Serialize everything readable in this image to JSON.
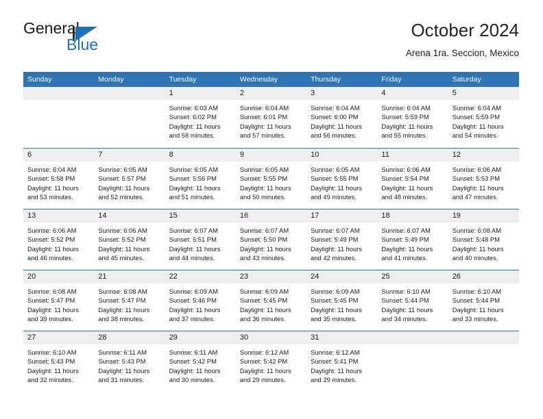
{
  "brand": {
    "name_part1": "General",
    "name_part2": "Blue",
    "logo_icon": "general-blue-triangle-logo",
    "accent_color": "#1c72b8"
  },
  "header": {
    "title": "October 2024",
    "subtitle": "Arena 1ra. Seccion, Mexico"
  },
  "calendar": {
    "header_bg": "#2f74b5",
    "weekdays": [
      "Sunday",
      "Monday",
      "Tuesday",
      "Wednesday",
      "Thursday",
      "Friday",
      "Saturday"
    ],
    "weeks": [
      [
        {
          "day": "",
          "lines": []
        },
        {
          "day": "",
          "lines": []
        },
        {
          "day": "1",
          "lines": [
            "Sunrise: 6:03 AM",
            "Sunset: 6:02 PM",
            "Daylight: 11 hours",
            "and 58 minutes."
          ]
        },
        {
          "day": "2",
          "lines": [
            "Sunrise: 6:04 AM",
            "Sunset: 6:01 PM",
            "Daylight: 11 hours",
            "and 57 minutes."
          ]
        },
        {
          "day": "3",
          "lines": [
            "Sunrise: 6:04 AM",
            "Sunset: 6:00 PM",
            "Daylight: 11 hours",
            "and 56 minutes."
          ]
        },
        {
          "day": "4",
          "lines": [
            "Sunrise: 6:04 AM",
            "Sunset: 5:59 PM",
            "Daylight: 11 hours",
            "and 55 minutes."
          ]
        },
        {
          "day": "5",
          "lines": [
            "Sunrise: 6:04 AM",
            "Sunset: 5:59 PM",
            "Daylight: 11 hours",
            "and 54 minutes."
          ]
        }
      ],
      [
        {
          "day": "6",
          "lines": [
            "Sunrise: 6:04 AM",
            "Sunset: 5:58 PM",
            "Daylight: 11 hours",
            "and 53 minutes."
          ]
        },
        {
          "day": "7",
          "lines": [
            "Sunrise: 6:05 AM",
            "Sunset: 5:57 PM",
            "Daylight: 11 hours",
            "and 52 minutes."
          ]
        },
        {
          "day": "8",
          "lines": [
            "Sunrise: 6:05 AM",
            "Sunset: 5:56 PM",
            "Daylight: 11 hours",
            "and 51 minutes."
          ]
        },
        {
          "day": "9",
          "lines": [
            "Sunrise: 6:05 AM",
            "Sunset: 5:55 PM",
            "Daylight: 11 hours",
            "and 50 minutes."
          ]
        },
        {
          "day": "10",
          "lines": [
            "Sunrise: 6:05 AM",
            "Sunset: 5:55 PM",
            "Daylight: 11 hours",
            "and 49 minutes."
          ]
        },
        {
          "day": "11",
          "lines": [
            "Sunrise: 6:06 AM",
            "Sunset: 5:54 PM",
            "Daylight: 11 hours",
            "and 48 minutes."
          ]
        },
        {
          "day": "12",
          "lines": [
            "Sunrise: 6:06 AM",
            "Sunset: 5:53 PM",
            "Daylight: 11 hours",
            "and 47 minutes."
          ]
        }
      ],
      [
        {
          "day": "13",
          "lines": [
            "Sunrise: 6:06 AM",
            "Sunset: 5:52 PM",
            "Daylight: 11 hours",
            "and 46 minutes."
          ]
        },
        {
          "day": "14",
          "lines": [
            "Sunrise: 6:06 AM",
            "Sunset: 5:52 PM",
            "Daylight: 11 hours",
            "and 45 minutes."
          ]
        },
        {
          "day": "15",
          "lines": [
            "Sunrise: 6:07 AM",
            "Sunset: 5:51 PM",
            "Daylight: 11 hours",
            "and 44 minutes."
          ]
        },
        {
          "day": "16",
          "lines": [
            "Sunrise: 6:07 AM",
            "Sunset: 5:50 PM",
            "Daylight: 11 hours",
            "and 43 minutes."
          ]
        },
        {
          "day": "17",
          "lines": [
            "Sunrise: 6:07 AM",
            "Sunset: 5:49 PM",
            "Daylight: 11 hours",
            "and 42 minutes."
          ]
        },
        {
          "day": "18",
          "lines": [
            "Sunrise: 6:07 AM",
            "Sunset: 5:49 PM",
            "Daylight: 11 hours",
            "and 41 minutes."
          ]
        },
        {
          "day": "19",
          "lines": [
            "Sunrise: 6:08 AM",
            "Sunset: 5:48 PM",
            "Daylight: 11 hours",
            "and 40 minutes."
          ]
        }
      ],
      [
        {
          "day": "20",
          "lines": [
            "Sunrise: 6:08 AM",
            "Sunset: 5:47 PM",
            "Daylight: 11 hours",
            "and 39 minutes."
          ]
        },
        {
          "day": "21",
          "lines": [
            "Sunrise: 6:08 AM",
            "Sunset: 5:47 PM",
            "Daylight: 11 hours",
            "and 38 minutes."
          ]
        },
        {
          "day": "22",
          "lines": [
            "Sunrise: 6:09 AM",
            "Sunset: 5:46 PM",
            "Daylight: 11 hours",
            "and 37 minutes."
          ]
        },
        {
          "day": "23",
          "lines": [
            "Sunrise: 6:09 AM",
            "Sunset: 5:45 PM",
            "Daylight: 11 hours",
            "and 36 minutes."
          ]
        },
        {
          "day": "24",
          "lines": [
            "Sunrise: 6:09 AM",
            "Sunset: 5:45 PM",
            "Daylight: 11 hours",
            "and 35 minutes."
          ]
        },
        {
          "day": "25",
          "lines": [
            "Sunrise: 6:10 AM",
            "Sunset: 5:44 PM",
            "Daylight: 11 hours",
            "and 34 minutes."
          ]
        },
        {
          "day": "26",
          "lines": [
            "Sunrise: 6:10 AM",
            "Sunset: 5:44 PM",
            "Daylight: 11 hours",
            "and 33 minutes."
          ]
        }
      ],
      [
        {
          "day": "27",
          "lines": [
            "Sunrise: 6:10 AM",
            "Sunset: 5:43 PM",
            "Daylight: 11 hours",
            "and 32 minutes."
          ]
        },
        {
          "day": "28",
          "lines": [
            "Sunrise: 6:11 AM",
            "Sunset: 5:43 PM",
            "Daylight: 11 hours",
            "and 31 minutes."
          ]
        },
        {
          "day": "29",
          "lines": [
            "Sunrise: 6:11 AM",
            "Sunset: 5:42 PM",
            "Daylight: 11 hours",
            "and 30 minutes."
          ]
        },
        {
          "day": "30",
          "lines": [
            "Sunrise: 6:12 AM",
            "Sunset: 5:42 PM",
            "Daylight: 11 hours",
            "and 29 minutes."
          ]
        },
        {
          "day": "31",
          "lines": [
            "Sunrise: 6:12 AM",
            "Sunset: 5:41 PM",
            "Daylight: 11 hours",
            "and 29 minutes."
          ]
        },
        {
          "day": "",
          "lines": []
        },
        {
          "day": "",
          "lines": []
        }
      ]
    ]
  }
}
